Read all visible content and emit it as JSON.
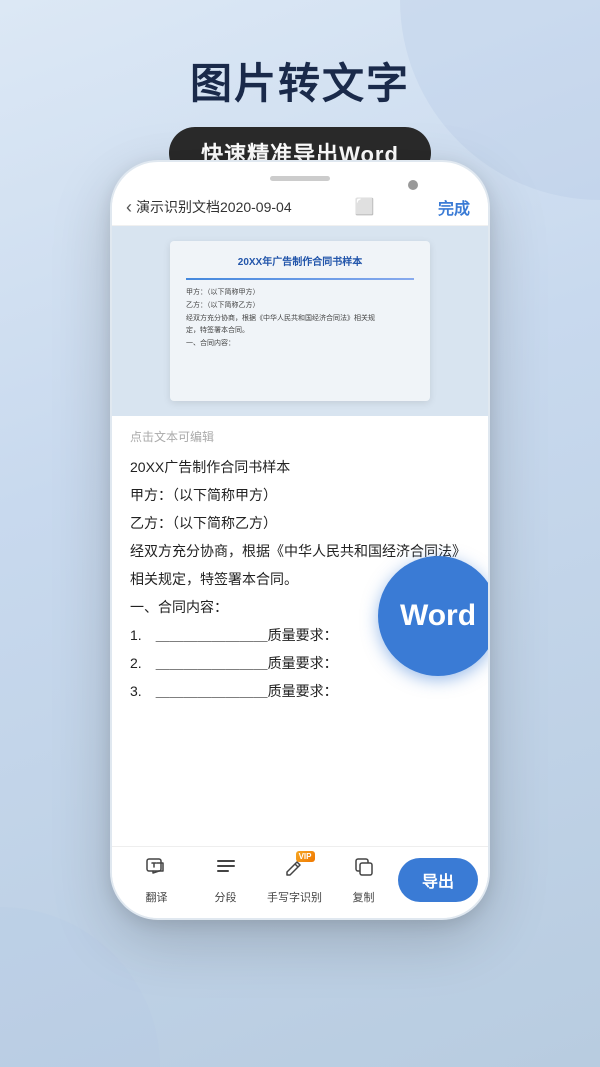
{
  "page": {
    "background_color": "#c8d9ee"
  },
  "header": {
    "main_title": "图片转文字",
    "subtitle": "快速精准导出Word"
  },
  "phone": {
    "navbar": {
      "back_label": "演示识别文档2020-09-04",
      "done_label": "完成"
    },
    "doc_image": {
      "title": "20XX年广告制作合同书样本",
      "lines": [
        "甲方：（以下简称甲方）",
        "乙方：（以下简称乙方）",
        "经双方充分协商，根据《中华人民共和国经济合同法》相关规",
        "定，特签署本合同。",
        "一、合同内容："
      ]
    },
    "ocr_hint": "点击文本可编辑",
    "ocr_text": [
      "20XX广告制作合同书样本",
      "甲方：（以下简称甲方）",
      "乙方：（以下简称乙方）",
      "经双方充分协商，根据《中华人民共和国经济合同法》",
      "相关规定，特签署本合同。",
      "一、合同内容：",
      "1.　＿＿＿＿＿＿＿＿质量要求：",
      "2.　＿＿＿＿＿＿＿＿质量要求：",
      "3.　＿＿＿＿＿＿＿＿质量要求："
    ],
    "word_badge": "Word",
    "toolbar": {
      "items": [
        {
          "icon": "A+",
          "label": "翻译",
          "vip": false
        },
        {
          "icon": "≡",
          "label": "分段",
          "vip": false
        },
        {
          "icon": "✎",
          "label": "手写字识别",
          "vip": true
        },
        {
          "icon": "⿻",
          "label": "复制",
          "vip": false
        }
      ],
      "export_button": "导出"
    }
  }
}
